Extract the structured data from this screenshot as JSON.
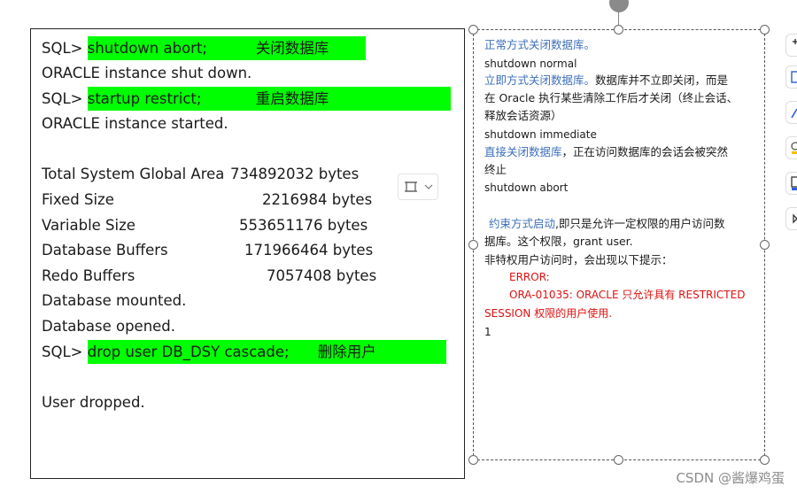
{
  "console": {
    "lines": [
      {
        "prompt": "SQL> ",
        "cmd": "shutdown abort;",
        "note": "关闭数据库"
      },
      {
        "text": "ORACLE instance shut down."
      },
      {
        "prompt": "SQL> ",
        "cmd": "startup restrict;",
        "note": "重启数据库"
      },
      {
        "text": "ORACLE instance started."
      },
      {
        "label": "Total System Global Area",
        "value": "734892032 bytes"
      },
      {
        "label": "Fixed Size",
        "value": "2216984 bytes"
      },
      {
        "label": "Variable Size",
        "value": "553651176 bytes"
      },
      {
        "label": "Database Buffers",
        "value": "171966464 bytes"
      },
      {
        "label": "Redo Buffers",
        "value": "7057408 bytes"
      },
      {
        "text": "Database mounted."
      },
      {
        "text": "Database opened."
      },
      {
        "prompt": "SQL> ",
        "cmd": "drop user DB_DSY cascade;",
        "note": "删除用户"
      },
      {
        "text": "User dropped."
      }
    ]
  },
  "textbox": {
    "l1": "正常方式关闭数据库。",
    "l2": "shutdown normal",
    "l3a": "立即方式关闭数据库。",
    "l3b": "数据库并不立即关闭，而是",
    "l4": "在 Oracle 执行某些清除工作后才关闭（终止会话、",
    "l5": "释放会话资源）",
    "l6": "shutdown immediate",
    "l7a": "直接关闭数据库",
    "l7b": "，正在访问数据库的会话会被突然",
    "l8": "终止",
    "l9": "shutdown abort",
    "l10a": "约束方式启动",
    "l10b": ",即只是允许一定权限的用户访问数",
    "l11": "据库。这个权限，grant user.",
    "l12": "非特权用户访问时，会出现以下提示：",
    "l13": "ERROR:",
    "l14": "ORA-01035: ORACLE  只允许具有   RESTRICTED",
    "l15": "SESSION  权限的用户使用.",
    "l16": "1"
  },
  "watermark": "CSDN @酱爆鸡蛋",
  "colors": {
    "highlight": "#00ff00",
    "link_blue": "#3d6fb8",
    "error_red": "#e01010"
  }
}
